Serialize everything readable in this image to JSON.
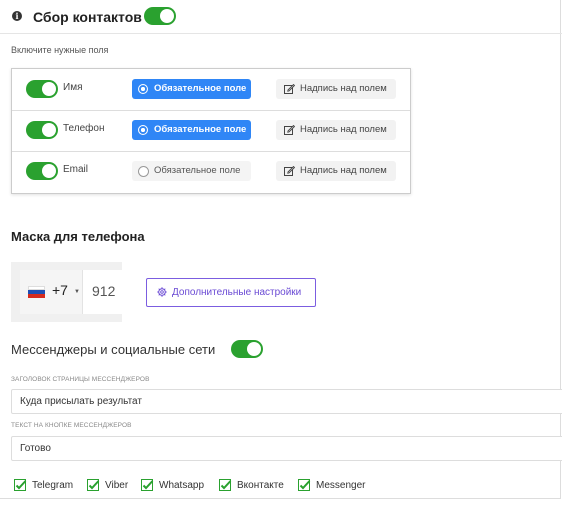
{
  "header": {
    "title": "Сбор контактов",
    "enabled": true
  },
  "fields_hint": "Включите нужные поля",
  "fields": [
    {
      "label": "Имя",
      "enabled": true,
      "required": true,
      "required_label": "Обязательное поле",
      "caption_label": "Надпись над полем"
    },
    {
      "label": "Телефон",
      "enabled": true,
      "required": true,
      "required_label": "Обязательное поле",
      "caption_label": "Надпись над полем"
    },
    {
      "label": "Email",
      "enabled": true,
      "required": false,
      "required_label": "Обязательное поле",
      "caption_label": "Надпись над полем"
    }
  ],
  "phone_mask": {
    "title": "Маска для телефона",
    "country_code": "+7",
    "number_preview": "912",
    "advanced_button": "Дополнительные настройки"
  },
  "messengers": {
    "title": "Мессенджеры и социальные сети",
    "enabled": true,
    "page_title_label": "Заголовок страницы мессенджеров",
    "page_title_value": "Куда присылать результат",
    "button_text_label": "Текст на кнопке мессенджеров",
    "button_text_value": "Готово",
    "options": [
      {
        "label": "Telegram",
        "checked": true
      },
      {
        "label": "Viber",
        "checked": true
      },
      {
        "label": "Whatsapp",
        "checked": true
      },
      {
        "label": "Вконтакте",
        "checked": true
      },
      {
        "label": "Messenger",
        "checked": true
      }
    ]
  },
  "colors": {
    "toggle_on": "#2aa12f",
    "primary": "#2f86f6",
    "accent_purple": "#6a4ad4",
    "check_green": "#2aa12f"
  }
}
